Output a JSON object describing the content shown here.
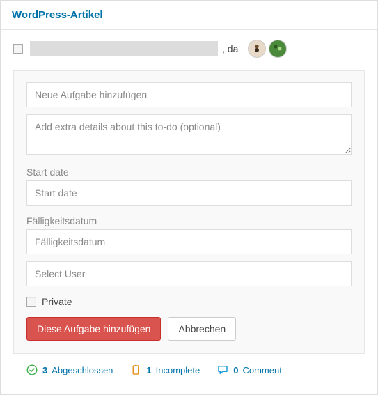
{
  "header": {
    "title": "WordPress-Artikel"
  },
  "item": {
    "suffix": ", da"
  },
  "form": {
    "title_placeholder": "Neue Aufgabe hinzufügen",
    "details_placeholder": "Add extra details about this to-do (optional)",
    "start_label": "Start date",
    "start_placeholder": "Start date",
    "due_label": "Fälligkeitsdatum",
    "due_placeholder": "Fälligkeitsdatum",
    "user_placeholder": "Select User",
    "private_label": "Private",
    "submit_label": "Diese Aufgabe hinzufügen",
    "cancel_label": "Abbrechen"
  },
  "footer": {
    "completed_count": "3",
    "completed_label": "Abgeschlossen",
    "incomplete_count": "1",
    "incomplete_label": "Incomplete",
    "comment_count": "0",
    "comment_label": "Comment"
  }
}
